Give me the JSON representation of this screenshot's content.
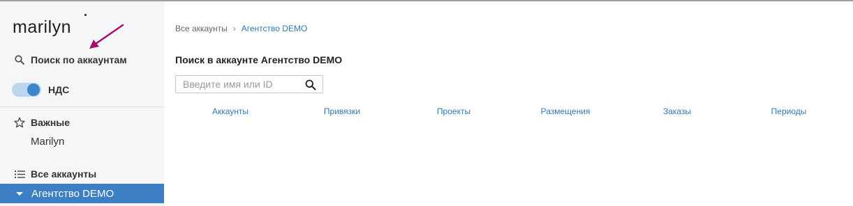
{
  "sidebar": {
    "logo": "marilyn",
    "search_label": "Поиск по аккаунтам",
    "vat_label": "НДС",
    "vat_enabled": true,
    "favorites_label": "Важные",
    "favorites_items": [
      "Marilyn"
    ],
    "all_accounts_label": "Все аккаунты",
    "active_account": "Агентство DEMO"
  },
  "breadcrumb": {
    "root": "Все аккаунты",
    "separator": "›",
    "current": "Агентство DEMO"
  },
  "main": {
    "title": "Поиск в аккаунте Агентство DEMO",
    "search": {
      "placeholder": "Введите имя или ID",
      "value": ""
    },
    "tabs": [
      "Аккаунты",
      "Привязки",
      "Проекты",
      "Размещения",
      "Заказы",
      "Периоды"
    ]
  },
  "colors": {
    "accent": "#3d7fc4",
    "link": "#2f78b7",
    "sidebar_bg": "#f4f6f8",
    "annotation_arrow": "#a3106a"
  },
  "icons": {
    "search": "search-icon",
    "star": "star-icon",
    "list": "list-icon",
    "caret": "caret-down-icon",
    "arrow": "annotation-arrow-icon"
  }
}
